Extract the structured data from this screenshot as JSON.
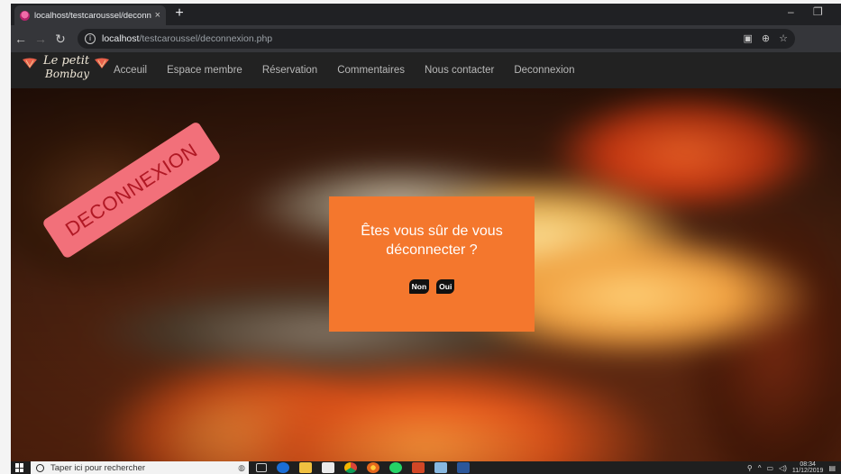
{
  "browser": {
    "tab_title": "localhost/testcaroussel/deconnex",
    "tab_close": "×",
    "new_tab": "+",
    "url_host": "localhost",
    "url_path": "/testcaroussel/deconnexion.php",
    "minimize": "–",
    "maximize": "❐"
  },
  "site": {
    "logo_line1": "Le petit",
    "logo_line2": "Bombay",
    "nav": [
      {
        "label": "Acceuil"
      },
      {
        "label": "Espace membre"
      },
      {
        "label": "Réservation"
      },
      {
        "label": "Commentaires"
      },
      {
        "label": "Nous contacter"
      },
      {
        "label": "Deconnexion"
      }
    ]
  },
  "hero": {
    "stamp_text": "DECONNEXION",
    "dialog": {
      "question": "Êtes vous sûr de vous déconnecter ?",
      "no_label": "Non",
      "yes_label": "Oui"
    }
  },
  "taskbar": {
    "search_placeholder": "Taper ici pour rechercher",
    "time": "08:34",
    "date": "11/12/2019"
  },
  "colors": {
    "dialog_bg": "#f4772d",
    "stamp_bg": "#f2707a",
    "stamp_text": "#b01824",
    "nav_bg": "#222222"
  }
}
